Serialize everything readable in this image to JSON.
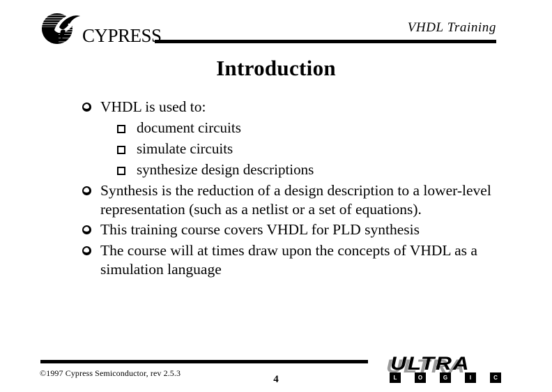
{
  "header": {
    "logo_text": "CYPRESS",
    "logo_icon": "cypress-globe-logo",
    "title": "VHDL Training"
  },
  "slide": {
    "title": "Introduction",
    "bullets": [
      {
        "level": 1,
        "marker": "shadowed-circle",
        "text": "VHDL is used to:"
      },
      {
        "level": 2,
        "marker": "shadowed-square",
        "text": "document circuits"
      },
      {
        "level": 2,
        "marker": "shadowed-square",
        "text": "simulate circuits"
      },
      {
        "level": 2,
        "marker": "shadowed-square",
        "text": "synthesize design descriptions"
      },
      {
        "level": 1,
        "marker": "shadowed-circle",
        "text": "Synthesis is the reduction of a design description to a lower-level representation (such as a netlist or a set of equations)."
      },
      {
        "level": 1,
        "marker": "shadowed-circle",
        "text": "This training course covers VHDL for PLD synthesis"
      },
      {
        "level": 1,
        "marker": "shadowed-circle",
        "text": "The course will at times draw upon the concepts of VHDL as a simulation language"
      }
    ]
  },
  "footer": {
    "copyright": "©1997 Cypress Semiconductor, rev 2.5.3",
    "page_number": "4",
    "brand_logo": {
      "wordmark": "ULTRA",
      "sub_letters": [
        "L",
        "O",
        "G",
        "I",
        "C"
      ],
      "shadow_color": "#9a9a9a",
      "wordmark_color": "#000000"
    }
  }
}
